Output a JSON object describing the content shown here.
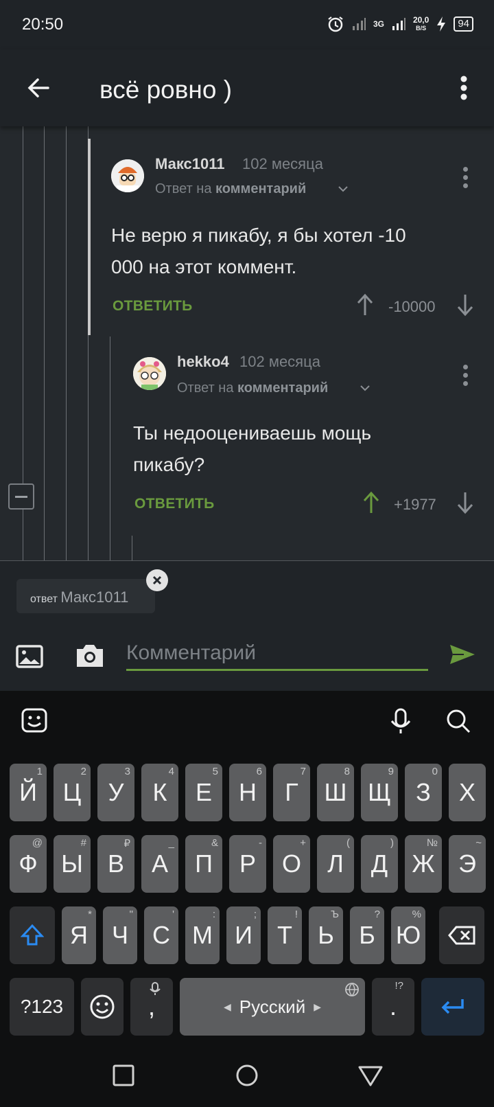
{
  "status": {
    "time": "20:50",
    "net_type": "3G",
    "speed_value": "20,0",
    "speed_unit": "B/S",
    "battery": "94"
  },
  "header": {
    "title": "всё ровно )"
  },
  "comments": [
    {
      "author": "Макс1011",
      "time": "102 месяца",
      "reply_prefix": "Ответ на",
      "reply_target": "комментарий",
      "text_line1": "Не верю я пикабу, я бы хотел -10",
      "text_line2": "000 на этот коммент.",
      "reply_label": "ОТВЕТИТЬ",
      "score": "-10000",
      "voted": "none"
    },
    {
      "author": "hekko4",
      "time": "102 месяца",
      "reply_prefix": "Ответ на",
      "reply_target": "комментарий",
      "text_line1": "Ты недооцениваешь мощь",
      "text_line2": "пикабу?",
      "reply_label": "ОТВЕТИТЬ",
      "score": "+1977",
      "voted": "up"
    }
  ],
  "composer": {
    "reply_small": "ответ",
    "reply_nick": "Макс1011",
    "placeholder": "Комментарий"
  },
  "keyboard": {
    "row1": [
      {
        "k": "Й",
        "h": "1"
      },
      {
        "k": "Ц",
        "h": "2"
      },
      {
        "k": "У",
        "h": "3"
      },
      {
        "k": "К",
        "h": "4"
      },
      {
        "k": "Е",
        "h": "5"
      },
      {
        "k": "Н",
        "h": "6"
      },
      {
        "k": "Г",
        "h": "7"
      },
      {
        "k": "Ш",
        "h": "8"
      },
      {
        "k": "Щ",
        "h": "9"
      },
      {
        "k": "З",
        "h": "0"
      },
      {
        "k": "Х",
        "h": ""
      }
    ],
    "row2": [
      {
        "k": "Ф",
        "h": "@"
      },
      {
        "k": "Ы",
        "h": "#"
      },
      {
        "k": "В",
        "h": "₽"
      },
      {
        "k": "А",
        "h": "_"
      },
      {
        "k": "П",
        "h": "&"
      },
      {
        "k": "Р",
        "h": "-"
      },
      {
        "k": "О",
        "h": "+"
      },
      {
        "k": "Л",
        "h": "("
      },
      {
        "k": "Д",
        "h": ")"
      },
      {
        "k": "Ж",
        "h": "№"
      },
      {
        "k": "Э",
        "h": "~"
      }
    ],
    "row3": [
      {
        "k": "Я",
        "h": "*"
      },
      {
        "k": "Ч",
        "h": "\""
      },
      {
        "k": "С",
        "h": "'"
      },
      {
        "k": "М",
        "h": ":"
      },
      {
        "k": "И",
        "h": ";"
      },
      {
        "k": "Т",
        "h": "!"
      },
      {
        "k": "Ь",
        "h": "Ъ"
      },
      {
        "k": "Б",
        "h": "?"
      },
      {
        "k": "Ю",
        "h": "%"
      }
    ],
    "sym_label": "?123",
    "comma": ",",
    "space_label": "Русский",
    "period": ".",
    "period_hint": "!?"
  },
  "colors": {
    "accent": "#6a9a3e",
    "keyboard_accent": "#2a8bf2",
    "background": "#25292d"
  }
}
